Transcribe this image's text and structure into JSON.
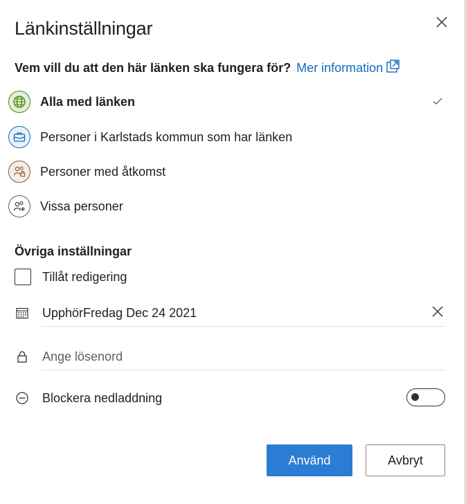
{
  "dialog": {
    "title": "Länkinställningar",
    "close_icon": "close-icon"
  },
  "question": {
    "text": "Vem vill du att den här länken ska fungera för?",
    "link_text": "Mer information",
    "link_icon": "external-link-icon"
  },
  "options": [
    {
      "label": "Alla med länken",
      "icon": "globe-icon",
      "selected": true,
      "color": "#498205"
    },
    {
      "label": "Personer i Karlstads kommun som har länken",
      "icon": "briefcase-icon",
      "selected": false,
      "color": "#0f6cbd"
    },
    {
      "label": "Personer med åtkomst",
      "icon": "people-lock-icon",
      "selected": false,
      "color": "#8e562e"
    },
    {
      "label": "Vissa personer",
      "icon": "people-add-icon",
      "selected": false,
      "color": "#605e5c"
    }
  ],
  "other_settings": {
    "heading": "Övriga inställningar",
    "allow_edit_label": "Tillåt redigering",
    "allow_edit_checked": false,
    "expiry_label": "Upphör",
    "expiry_value": "Fredag Dec 24 2021",
    "password_placeholder": "Ange lösenord",
    "block_download_label": "Blockera nedladdning",
    "block_download_on": false
  },
  "buttons": {
    "apply": "Använd",
    "cancel": "Avbryt"
  },
  "colors": {
    "accent": "#2b7cd3",
    "link": "#0f6cbd"
  }
}
